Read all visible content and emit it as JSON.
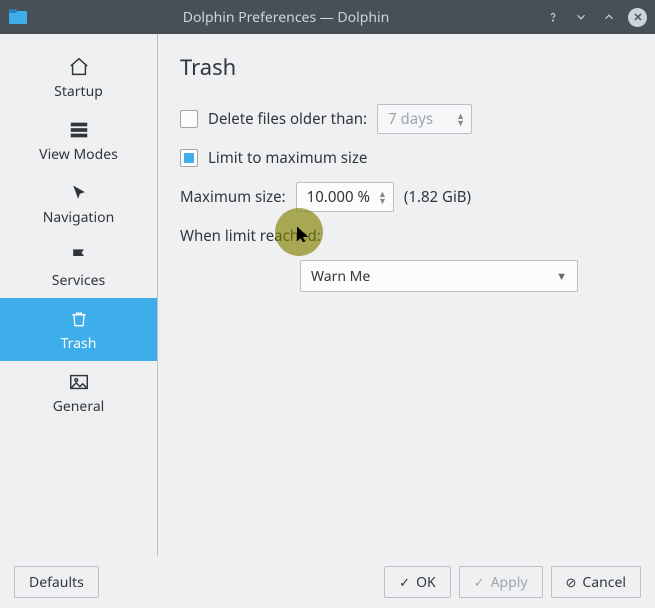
{
  "window": {
    "title": "Dolphin Preferences — Dolphin"
  },
  "sidebar": {
    "items": [
      {
        "label": "Startup"
      },
      {
        "label": "View Modes"
      },
      {
        "label": "Navigation"
      },
      {
        "label": "Services"
      },
      {
        "label": "Trash"
      },
      {
        "label": "General"
      }
    ]
  },
  "page": {
    "heading": "Trash",
    "delete_older_label": "Delete files older than:",
    "delete_older_value": "7 days",
    "limit_max_label": "Limit to maximum size",
    "max_size_label": "Maximum size:",
    "max_size_value": "10.000 %",
    "max_size_bytes": "(1.82 GiB)",
    "when_limit_label": "When limit reached:",
    "when_limit_value": "Warn Me"
  },
  "footer": {
    "defaults": "Defaults",
    "ok": "OK",
    "apply": "Apply",
    "cancel": "Cancel"
  }
}
